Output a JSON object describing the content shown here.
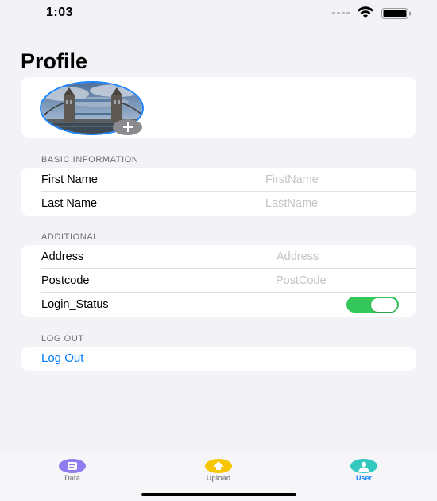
{
  "status_bar": {
    "time": "1:03"
  },
  "page": {
    "title": "Profile"
  },
  "avatar": {
    "alt": "Tower Bridge photo"
  },
  "sections": {
    "basic": {
      "header": "BASIC INFORMATION",
      "first_name": {
        "label": "First Name",
        "value": "",
        "placeholder": "FirstName"
      },
      "last_name": {
        "label": "Last Name",
        "value": "",
        "placeholder": "LastName"
      }
    },
    "additional": {
      "header": "ADDITIONAL",
      "address": {
        "label": "Address",
        "value": "",
        "placeholder": "Address"
      },
      "postcode": {
        "label": "Postcode",
        "value": "",
        "placeholder": "PostCode"
      },
      "login_status": {
        "label": "Login_Status",
        "on": true
      }
    },
    "logout": {
      "header": "LOG OUT",
      "button_label": "Log Out"
    }
  },
  "tab_bar": {
    "tabs": [
      {
        "label": "Data",
        "icon": "document-icon",
        "color": "#8e7cf0",
        "active": false
      },
      {
        "label": "Upload",
        "icon": "upload-icon",
        "color": "#f7c600",
        "active": false
      },
      {
        "label": "User",
        "icon": "user-icon",
        "color": "#34c9c0",
        "active": true
      }
    ]
  },
  "colors": {
    "accent": "#007aff",
    "toggle_on": "#34c759",
    "background": "#f2f2f7"
  }
}
